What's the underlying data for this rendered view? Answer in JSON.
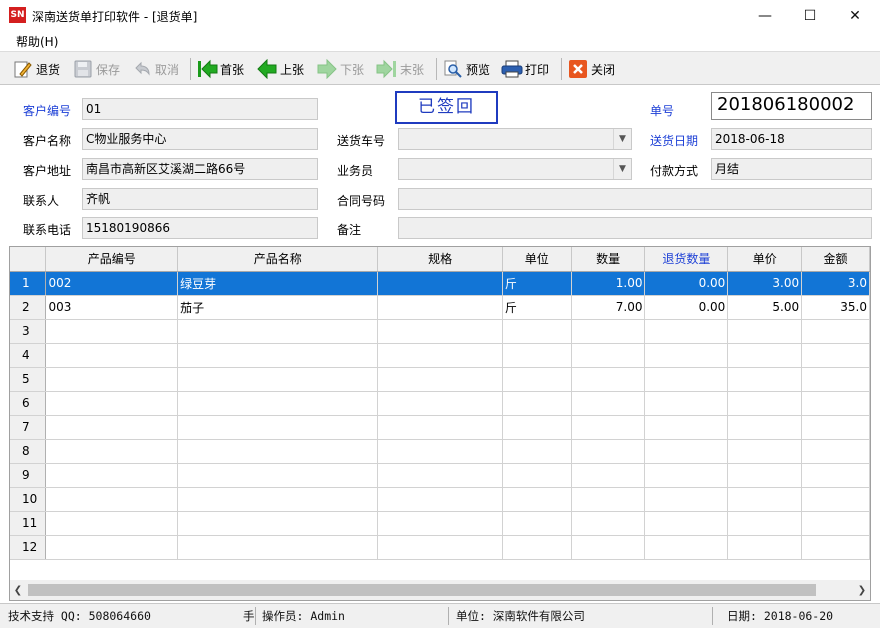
{
  "window": {
    "icon_text": "SN",
    "title": "深南送货单打印软件 - [退货单]",
    "min": "—",
    "max": "☐",
    "close": "✕"
  },
  "menu": {
    "help": "帮助(H)"
  },
  "toolbar": {
    "return": "退货",
    "save": "保存",
    "cancel": "取消",
    "first": "首张",
    "prev": "上张",
    "next": "下张",
    "last": "末张",
    "preview": "预览",
    "print": "打印",
    "close": "关闭"
  },
  "form": {
    "customer_no_label": "客户编号",
    "customer_no": "01",
    "customer_name_label": "客户名称",
    "customer_name": "C物业服务中心",
    "customer_addr_label": "客户地址",
    "customer_addr": "南昌市高新区艾溪湖二路66号",
    "contact_label": "联系人",
    "contact": "齐帆",
    "phone_label": "联系电话",
    "phone": "15180190866",
    "vehicle_label": "送货车号",
    "vehicle": "",
    "salesman_label": "业务员",
    "salesman": "",
    "contract_label": "合同号码",
    "contract": "",
    "remark_label": "备注",
    "remark": "",
    "stamp": "已签回",
    "order_no_label": "单号",
    "order_no": "201806180002",
    "date_label": "送货日期",
    "date": "2018-06-18",
    "payment_label": "付款方式",
    "payment": "月结"
  },
  "grid": {
    "columns": [
      "",
      "产品编号",
      "产品名称",
      "规格",
      "单位",
      "数量",
      "退货数量",
      "单价",
      "金额"
    ],
    "rows": [
      [
        "1",
        "002",
        "绿豆芽",
        "",
        "斤",
        "1.00",
        "0.00",
        "3.00",
        "3.0"
      ],
      [
        "2",
        "003",
        "茄子",
        "",
        "斤",
        "7.00",
        "0.00",
        "5.00",
        "35.0"
      ],
      [
        "3",
        "",
        "",
        "",
        "",
        "",
        "",
        "",
        ""
      ],
      [
        "4",
        "",
        "",
        "",
        "",
        "",
        "",
        "",
        ""
      ],
      [
        "5",
        "",
        "",
        "",
        "",
        "",
        "",
        "",
        ""
      ],
      [
        "6",
        "",
        "",
        "",
        "",
        "",
        "",
        "",
        ""
      ],
      [
        "7",
        "",
        "",
        "",
        "",
        "",
        "",
        "",
        ""
      ],
      [
        "8",
        "",
        "",
        "",
        "",
        "",
        "",
        "",
        ""
      ],
      [
        "9",
        "",
        "",
        "",
        "",
        "",
        "",
        "",
        ""
      ],
      [
        "10",
        "",
        "",
        "",
        "",
        "",
        "",
        "",
        ""
      ],
      [
        "11",
        "",
        "",
        "",
        "",
        "",
        "",
        "",
        ""
      ],
      [
        "12",
        "",
        "",
        "",
        "",
        "",
        "",
        "",
        ""
      ]
    ]
  },
  "status": {
    "support": "技术支持 QQ: 508064660",
    "hand": "手",
    "operator": "操作员: Admin",
    "company": "单位: 深南软件有限公司",
    "date": "日期:  2018-06-20"
  },
  "colors": {
    "accent": "#1275d6",
    "label_blue": "#1c3fd6",
    "stamp": "#1f3bbf"
  }
}
